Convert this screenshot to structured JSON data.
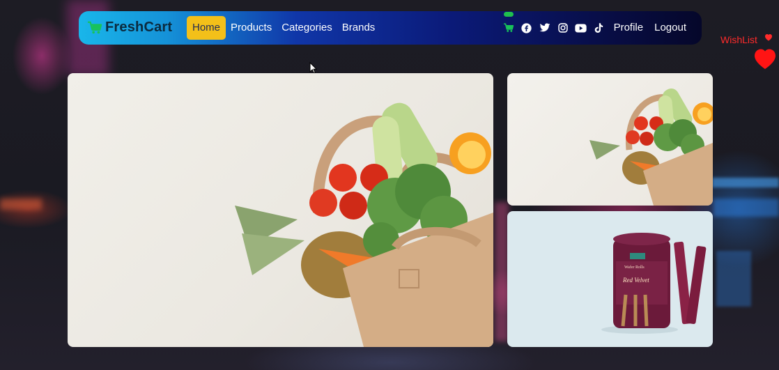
{
  "brand": {
    "name": "FreshCart",
    "icon": "shopping-cart-icon",
    "color": "#0b2a3e",
    "icon_color": "#18c25a"
  },
  "nav": {
    "links": [
      {
        "label": "Home",
        "active": true
      },
      {
        "label": "Products",
        "active": false
      },
      {
        "label": "Categories",
        "active": false
      },
      {
        "label": "Brands",
        "active": false
      }
    ],
    "active_color": "#f3c019"
  },
  "right_nav": {
    "icons": [
      "cart-icon",
      "facebook-icon",
      "twitter-icon",
      "instagram-icon",
      "youtube-icon",
      "tiktok-icon"
    ],
    "profile_label": "Profile",
    "logout_label": "Logout",
    "cart_badge_color": "#1fbf4e"
  },
  "wishlist": {
    "label": "WishList",
    "color": "#ff2b2b",
    "icon": "heart-icon"
  },
  "slider": {
    "main_image": "grocery-bag-vegetables-image",
    "side_top_image": "grocery-bag-vegetables-small-image",
    "side_bottom_image": "red-velvet-wafer-rolls-image",
    "product_label_line1": "Wafer Rolls",
    "product_label_line2": "Red Velvet"
  }
}
